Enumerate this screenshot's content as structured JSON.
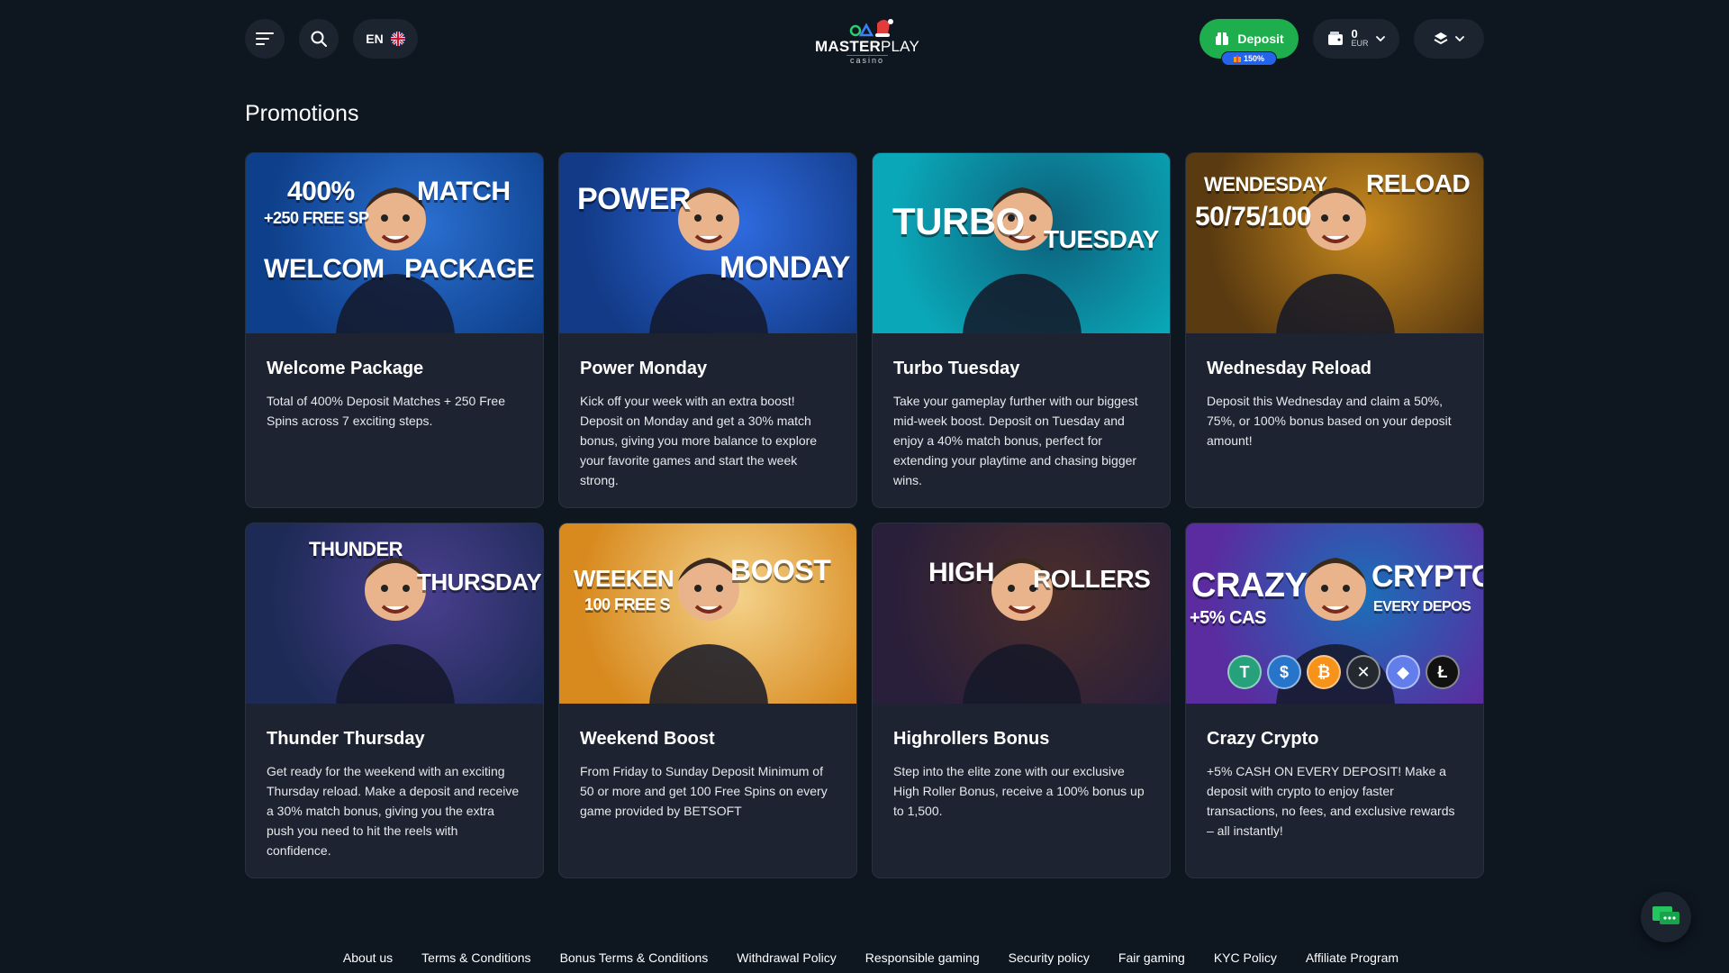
{
  "header": {
    "menu_icon": "hamburger-menu-icon",
    "search_icon": "search-icon",
    "language": "EN",
    "language_flag": "uk-flag-icon",
    "logo": {
      "brand_bold": "MASTER",
      "brand_light": "PLAY",
      "sub": "casino"
    },
    "deposit_label": "Deposit",
    "deposit_badge": "150%",
    "wallet": {
      "amount": "0",
      "currency": "EUR"
    },
    "account_icon": "user-layers-icon"
  },
  "page": {
    "title": "Promotions"
  },
  "promotions": [
    {
      "title": "Welcome Package",
      "description": "Total of 400% Deposit Matches + 250 Free Spins across 7 exciting steps.",
      "banner_lines": [
        "400%",
        "MATCH",
        "+250 FREE SP",
        "WELCOM",
        "PACKAGE"
      ],
      "colors": [
        "#0e3f8a",
        "#2a6fd0"
      ]
    },
    {
      "title": "Power Monday",
      "description": "Kick off your week with an extra boost! Deposit on Monday and get a 30% match bonus, giving you more balance to explore your favorite games and start the week strong.",
      "banner_lines": [
        "POWER",
        "MONDAY"
      ],
      "colors": [
        "#123a86",
        "#2f6be0"
      ]
    },
    {
      "title": "Turbo Tuesday",
      "description": "Take your gameplay further with our biggest mid-week boost. Deposit on Tuesday and enjoy a 40% match bonus, perfect for extending your playtime and chasing bigger wins.",
      "banner_lines": [
        "TURBO",
        "TUESDAY"
      ],
      "colors": [
        "#0aa7b8",
        "#0d5f7a"
      ]
    },
    {
      "title": "Wednesday Reload",
      "description": "Deposit this Wednesday and claim a 50%, 75%, or 100% bonus based on your deposit amount!",
      "banner_lines": [
        "WENDESDAY",
        "RELOAD",
        "50/75/100"
      ],
      "colors": [
        "#5a3a10",
        "#c98a1e"
      ]
    },
    {
      "title": "Thunder Thursday",
      "description": "Get ready for the weekend with an exciting Thursday reload. Make a deposit and receive a 30% match bonus, giving you the extra push you need to hit the reels with confidence.",
      "banner_lines": [
        "THUNDER",
        "THURSDAY"
      ],
      "colors": [
        "#1d2a55",
        "#4a3f8f"
      ]
    },
    {
      "title": "Weekend Boost",
      "description": "From Friday to Sunday Deposit Minimum of 50 or more and get 100 Free Spins on every game provided by BETSOFT",
      "banner_lines": [
        "WEEKEN",
        "BOOST",
        "100 FREE S"
      ],
      "colors": [
        "#d88a1f",
        "#f4d28a"
      ]
    },
    {
      "title": "Highrollers Bonus",
      "description": "Step into the elite zone with our exclusive High Roller Bonus, receive a 100% bonus up to 1,500.",
      "banner_lines": [
        "HIGH",
        "ROLLERS"
      ],
      "colors": [
        "#2a1f3a",
        "#4c2e2a"
      ]
    },
    {
      "title": "Crazy Crypto",
      "description": "+5% CASH ON EVERY DEPOSIT! Make a deposit with crypto to enjoy faster transactions, no fees, and exclusive rewards – all instantly!",
      "banner_lines": [
        "CRAZY",
        "CRYPTO",
        "+5% CAS",
        "EVERY DEPOS"
      ],
      "colors": [
        "#5a2ca0",
        "#1b6fb8"
      ],
      "coins": [
        "tether-icon",
        "usdc-icon",
        "bitcoin-icon",
        "xrp-icon",
        "ethereum-icon",
        "litecoin-icon"
      ]
    }
  ],
  "footer": {
    "links": [
      "About us",
      "Terms & Conditions",
      "Bonus Terms & Conditions",
      "Withdrawal Policy",
      "Responsible gaming",
      "Security policy",
      "Fair gaming",
      "KYC Policy",
      "Affiliate Program"
    ]
  },
  "chat_icon": "chat-bubble-icon"
}
